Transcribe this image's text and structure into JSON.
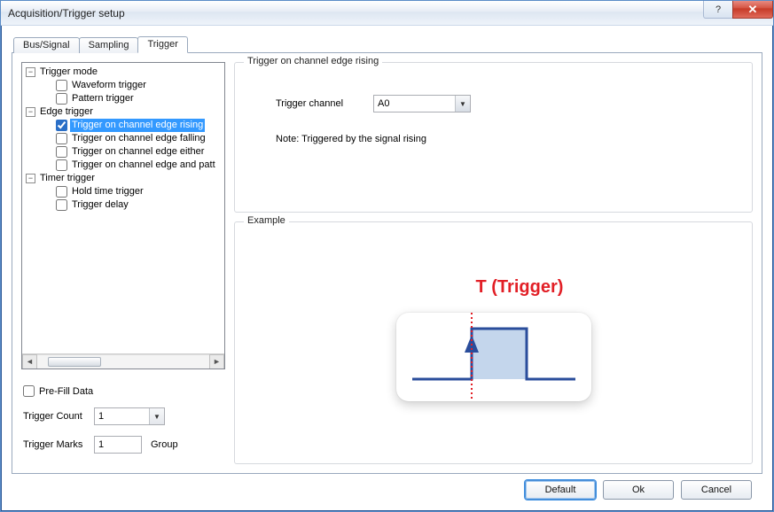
{
  "window": {
    "title": "Acquisition/Trigger setup"
  },
  "tabs": {
    "bus_signal": "Bus/Signal",
    "sampling": "Sampling",
    "trigger": "Trigger"
  },
  "tree": {
    "trigger_mode": {
      "label": "Trigger mode",
      "expander": "−"
    },
    "waveform_trigger": "Waveform trigger",
    "pattern_trigger": "Pattern trigger",
    "edge_trigger": {
      "label": "Edge trigger",
      "expander": "−"
    },
    "edge_rising": "Trigger on channel edge rising",
    "edge_falling": "Trigger on channel edge falling",
    "edge_either": "Trigger on channel edge either",
    "edge_pattern": "Trigger on channel edge and patt",
    "timer_trigger": {
      "label": "Timer trigger",
      "expander": "−"
    },
    "hold_time": "Hold time trigger",
    "trigger_delay": "Trigger delay",
    "selected": "edge_rising",
    "checked": {
      "edge_rising": true
    }
  },
  "left_bottom": {
    "prefill_label": "Pre-Fill Data",
    "trigger_count_label": "Trigger Count",
    "trigger_count_value": "1",
    "trigger_marks_label": "Trigger Marks",
    "trigger_marks_value": "1",
    "group_label": "Group"
  },
  "right": {
    "group_title": "Trigger on channel edge rising",
    "channel_label": "Trigger channel",
    "channel_value": "A0",
    "note": "Note: Triggered by the signal rising",
    "example_title": "Example",
    "t_label": "T (Trigger)"
  },
  "footer": {
    "default": "Default",
    "ok": "Ok",
    "cancel": "Cancel"
  },
  "titlebar_icons": {
    "help": "?",
    "close": "✕"
  }
}
